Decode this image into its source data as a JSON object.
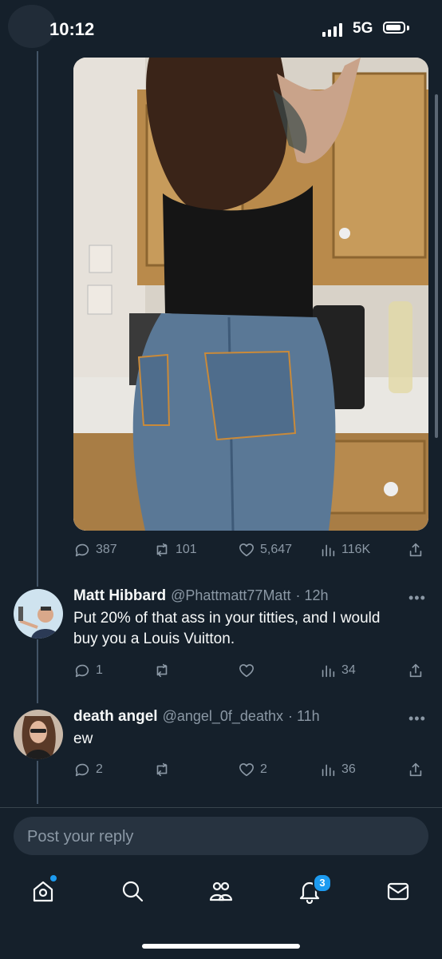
{
  "status_bar": {
    "time": "10:12",
    "network": "5G"
  },
  "main_post": {
    "stats": {
      "replies": "387",
      "reposts": "101",
      "likes": "5,647",
      "views": "116K"
    }
  },
  "replies": [
    {
      "name": "Matt Hibbard",
      "handle": "@Phattmatt77Matt",
      "time": "· 12h",
      "text": "Put 20% of that ass in your titties, and I would buy you a Louis Vuitton.",
      "stats": {
        "replies": "1",
        "reposts": "",
        "likes": "",
        "views": "34"
      }
    },
    {
      "name": "death angel",
      "handle": "@angel_0f_deathx",
      "time": "· 11h",
      "text": "ew",
      "stats": {
        "replies": "2",
        "reposts": "",
        "likes": "2",
        "views": "36"
      }
    }
  ],
  "more_glyph": "•••",
  "reply_box": {
    "placeholder": "Post your reply"
  },
  "bottom_nav": {
    "notifications_badge": "3"
  },
  "colors": {
    "background": "#15202b",
    "accent": "#1d9bf0",
    "muted": "#8b98a5"
  }
}
